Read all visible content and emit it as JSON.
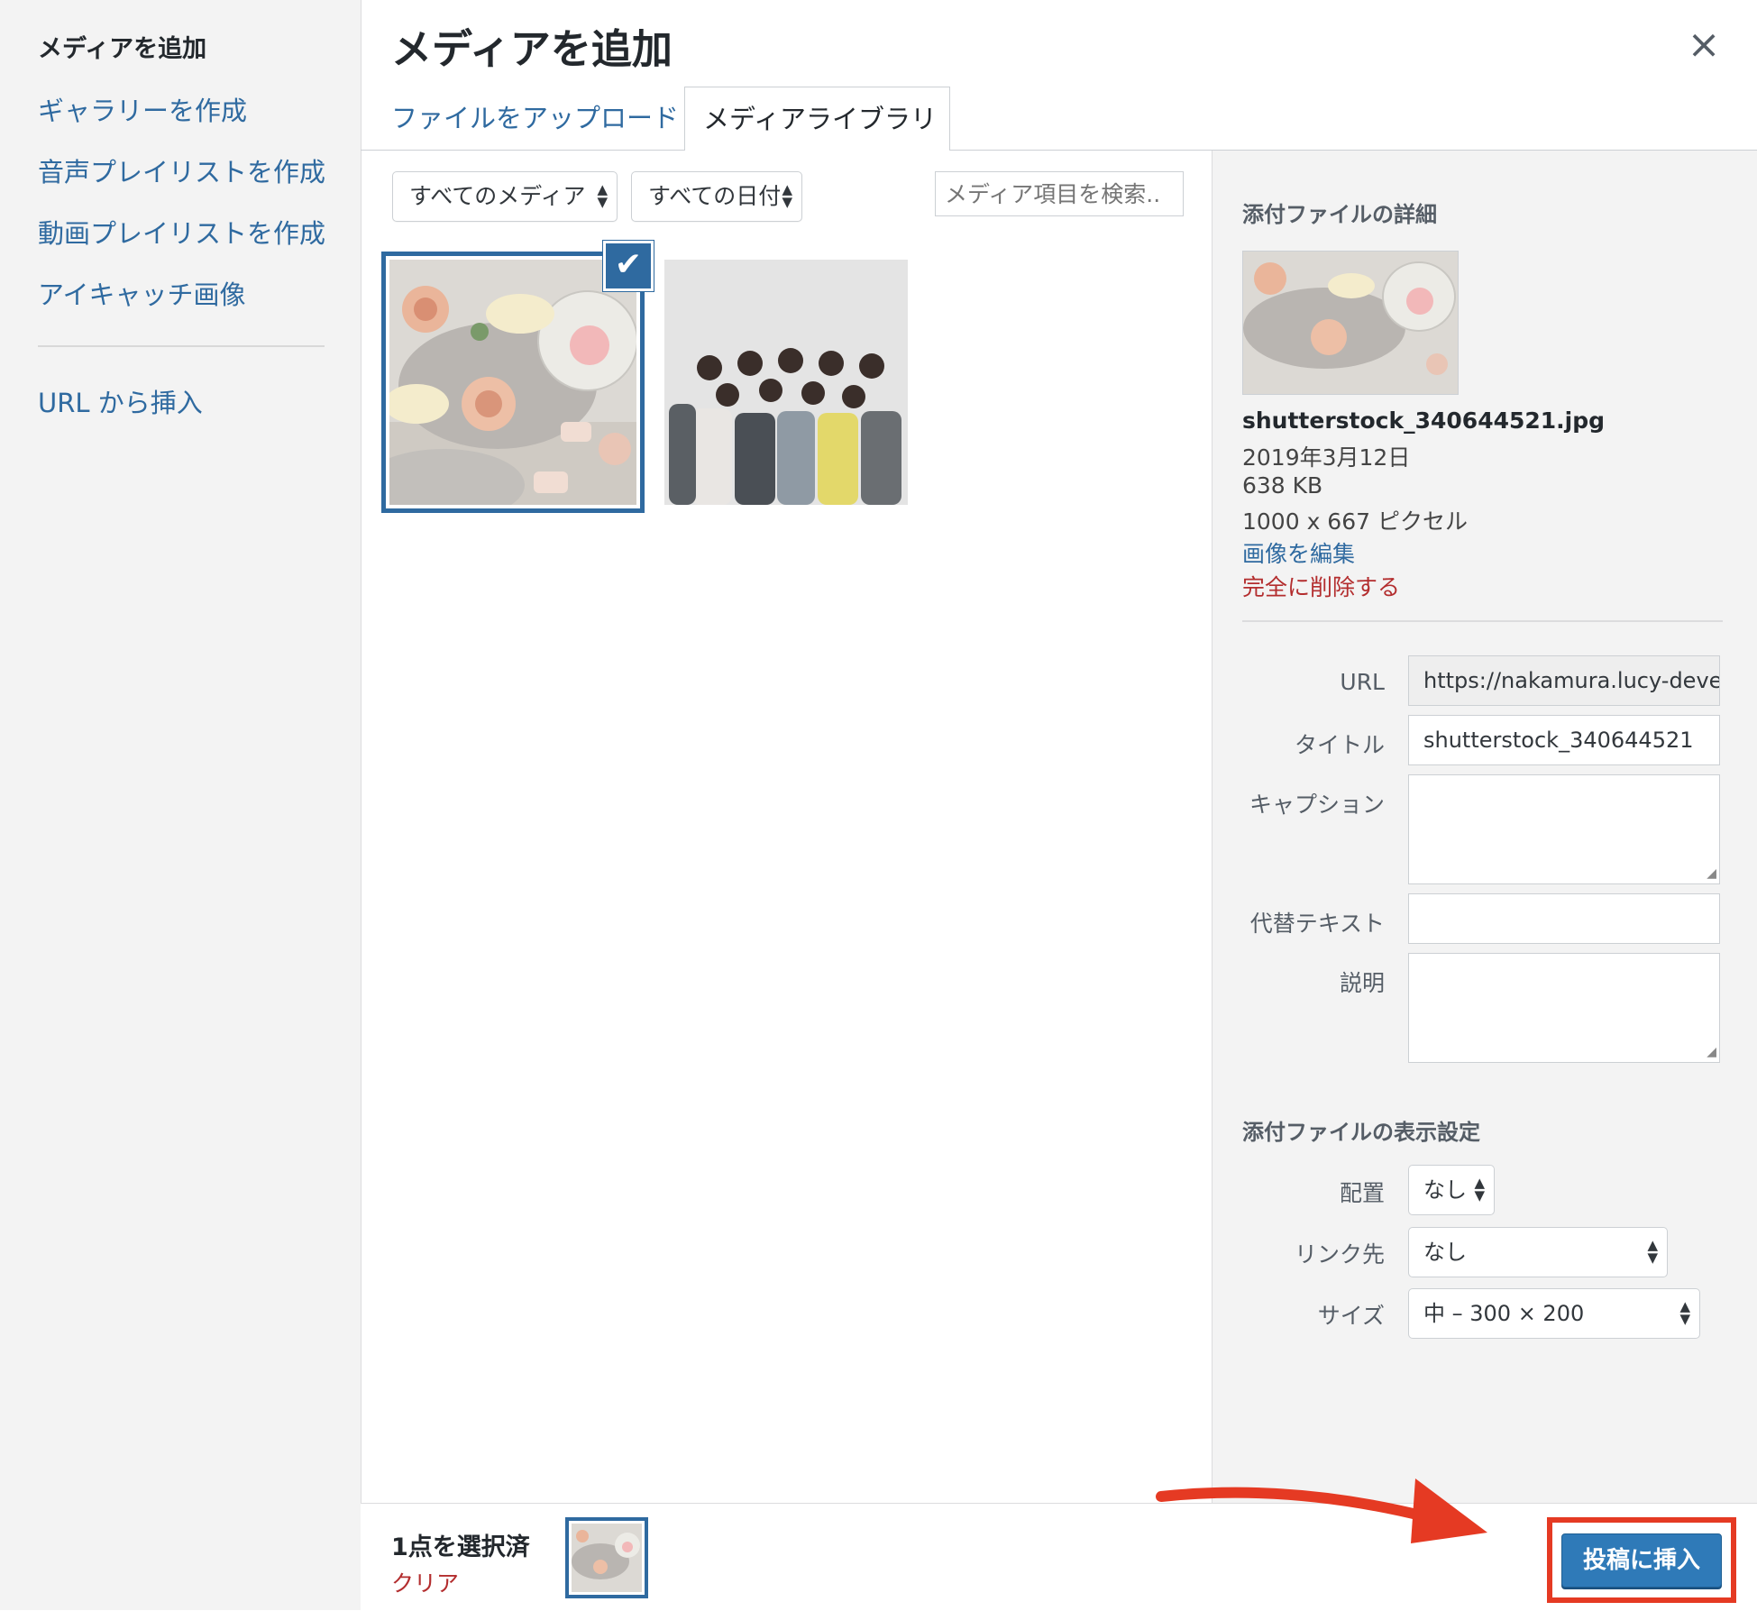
{
  "sidebar": {
    "heading": "メディアを追加",
    "items": [
      "ギャラリーを作成",
      "音声プレイリストを作成",
      "動画プレイリストを作成",
      "アイキャッチ画像"
    ],
    "url_insert": "URL から挿入"
  },
  "modal": {
    "title": "メディアを追加",
    "close": "×"
  },
  "tabs": {
    "upload": "ファイルをアップロード",
    "library": "メディアライブラリ"
  },
  "toolbar": {
    "media_filter": "すべてのメディア",
    "date_filter": "すべての日付",
    "search_placeholder": "メディア項目を検索..",
    "check": "✔"
  },
  "details": {
    "heading": "添付ファイルの詳細",
    "filename": "shutterstock_340644521.jpg",
    "date": "2019年3月12日",
    "filesize": "638 KB",
    "dimensions": "1000 x 667 ピクセル",
    "edit_link": "画像を編集",
    "delete_link": "完全に削除する",
    "fields": {
      "url_label": "URL",
      "url_value": "https://nakamura.lucy-deve",
      "title_label": "タイトル",
      "title_value": "shutterstock_340644521",
      "caption_label": "キャプション",
      "alt_label": "代替テキスト",
      "description_label": "説明"
    }
  },
  "display_settings": {
    "heading": "添付ファイルの表示設定",
    "align_label": "配置",
    "align_value": "なし",
    "link_label": "リンク先",
    "link_value": "なし",
    "size_label": "サイズ",
    "size_value": "中 – 300 × 200"
  },
  "footer": {
    "selected_count": "1点を選択済",
    "clear": "クリア",
    "insert_button": "投稿に挿入"
  },
  "colors": {
    "link": "#2f6aa0",
    "danger": "#b32d2e",
    "primary_button": "#2f7ab8",
    "highlight": "#e53a23"
  }
}
